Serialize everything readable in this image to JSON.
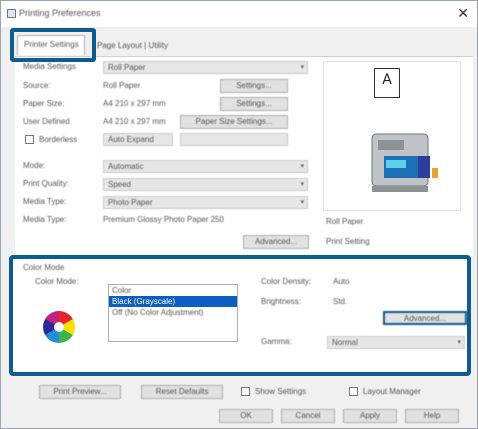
{
  "window": {
    "title": "Printing Preferences"
  },
  "tabs": [
    {
      "label": "Printer Settings"
    },
    {
      "label": "Page Layout  |  Utility"
    }
  ],
  "main": {
    "media_settings_label": "Media Settings",
    "media_settings_value": "Roll Paper",
    "source_label": "Source:",
    "source_value": "Roll Paper",
    "size_label": "Paper Size:",
    "size_value": "A4 210 x 297 mm",
    "size_btn": "Settings...",
    "border_label": "Borderless:",
    "border_value": "Auto Expand",
    "border_btn": "Settings...",
    "custom_label": "User Defined",
    "custom_value": "A4 210 x 297 mm",
    "custom_btn": "Paper Size Settings...",
    "checkbox_label": "Borderless",
    "paper_type_label": "Media Type:",
    "paper_type_value": "Photo Paper",
    "quality_label": "Print Quality:",
    "quality_value": "Speed",
    "mode_label": "Mode:",
    "mode_value": "Automatic",
    "media_label": "Media Type:",
    "media_value": "Premium Glossy Photo Paper 250",
    "media_btn": "Advanced...",
    "preview_paper": "A",
    "preview_note1": "Roll Paper",
    "preview_note2": "Print Setting"
  },
  "color": {
    "group_label": "Color Mode",
    "mode_label": "Color Mode:",
    "list_items": [
      "Color",
      "Black (Grayscale)",
      "Off (No Color Adjustment)"
    ],
    "selected_index": 1,
    "right_label1": "Color Density:",
    "right_value1": "Auto",
    "right_label2": "Brightness:",
    "right_value2": "Std.",
    "advanced_btn": "Advanced...",
    "gamma_label": "Gamma:",
    "gamma_value": "Normal"
  },
  "bottom": {
    "btn_left1": "Print Preview...",
    "btn_left2": "Reset Defaults",
    "check1": "Show Settings",
    "check2": "Layout Manager",
    "ok": "OK",
    "cancel": "Cancel",
    "apply": "Apply",
    "help": "Help"
  }
}
